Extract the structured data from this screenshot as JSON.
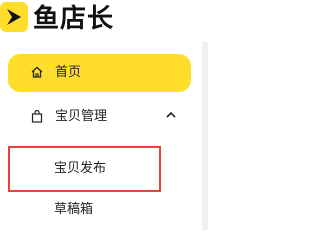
{
  "app": {
    "name": "鱼店长",
    "logo_icon": "play-arrow-logo-icon",
    "brand_color": "#FFDE2B"
  },
  "sidebar": {
    "items": [
      {
        "label": "首页",
        "icon": "home-icon",
        "active": true
      },
      {
        "label": "宝贝管理",
        "icon": "shopping-bag-icon",
        "expanded": true,
        "chevron": "chevron-up-icon",
        "children": [
          {
            "label": "宝贝发布",
            "highlighted": true
          },
          {
            "label": "草稿箱"
          }
        ]
      }
    ],
    "highlight_color": "#E8433A"
  }
}
